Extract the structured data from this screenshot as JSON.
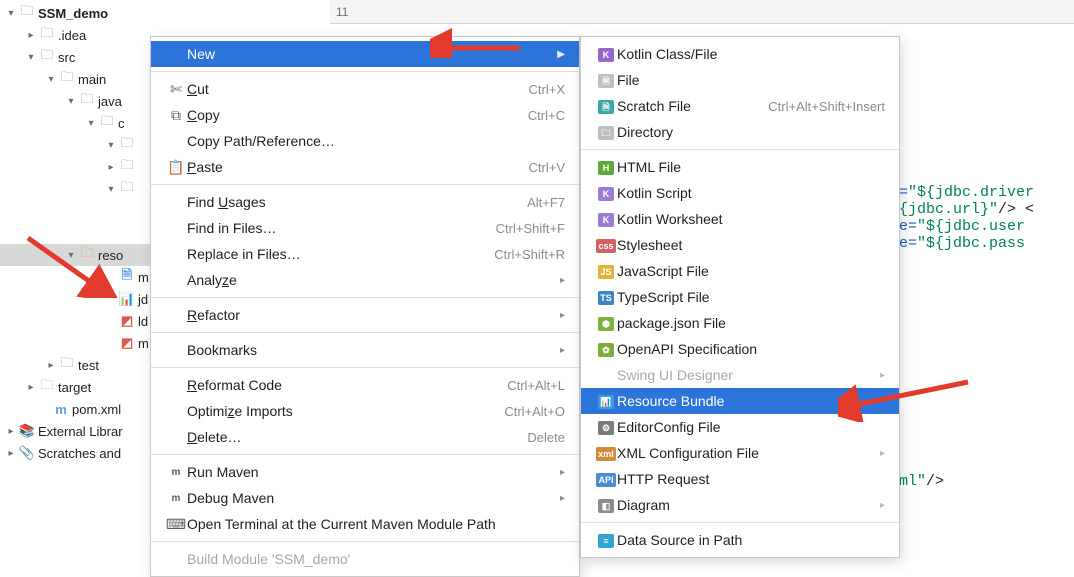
{
  "tabs": {
    "num": "11"
  },
  "tree": {
    "root": "SSM_demo",
    "idea": ".idea",
    "src": "src",
    "main": "main",
    "java": "java",
    "pkg_c": "c",
    "reso": "reso",
    "m1": "m",
    "jd": "jd",
    "ld": "ld",
    "m2": "m",
    "test": "test",
    "target": "target",
    "pom": "pom.xml",
    "extlib": "External Librar",
    "scratches": "Scratches and"
  },
  "editor": {
    "l1a": "e=",
    "l1v": "\"${jdbc.driver",
    "l2a": "",
    "l2v": "${jdbc.url}\"",
    "l2t": "/> <",
    "l3a": "ue=",
    "l3v": "\"${jdbc.user",
    "l4a": "ue=",
    "l4v": "\"${jdbc.pass",
    "l5v": "xml\"",
    "l5t": "/>"
  },
  "menu": {
    "new": "New",
    "cut": "Cut",
    "cut_s": "Ctrl+X",
    "copy": "Copy",
    "copy_s": "Ctrl+C",
    "cpr": "Copy Path/Reference…",
    "paste": "Paste",
    "paste_s": "Ctrl+V",
    "findU": "Find Usages",
    "findU_s": "Alt+F7",
    "fif": "Find in Files…",
    "fif_s": "Ctrl+Shift+F",
    "rif": "Replace in Files…",
    "rif_s": "Ctrl+Shift+R",
    "analyze": "Analyze",
    "refactor": "Refactor",
    "bookmarks": "Bookmarks",
    "reformat": "Reformat Code",
    "reformat_s": "Ctrl+Alt+L",
    "optimize": "Optimize Imports",
    "optimize_s": "Ctrl+Alt+O",
    "delete": "Delete…",
    "delete_s": "Delete",
    "runmvn": "Run Maven",
    "dbgmvn": "Debug Maven",
    "openterm": "Open Terminal at the Current Maven Module Path",
    "buildmod": "Build Module 'SSM_demo'"
  },
  "submenu": {
    "kclass": "Kotlin Class/File",
    "file": "File",
    "scratch": "Scratch File",
    "scratch_s": "Ctrl+Alt+Shift+Insert",
    "dir": "Directory",
    "html": "HTML File",
    "kscript": "Kotlin Script",
    "kws": "Kotlin Worksheet",
    "css": "Stylesheet",
    "js": "JavaScript File",
    "ts": "TypeScript File",
    "pkgjson": "package.json File",
    "openapi": "OpenAPI Specification",
    "swing": "Swing UI Designer",
    "rbundle": "Resource Bundle",
    "edcfg": "EditorConfig File",
    "xmlcfg": "XML Configuration File",
    "http": "HTTP Request",
    "diag": "Diagram",
    "dsip": "Data Source in Path"
  }
}
